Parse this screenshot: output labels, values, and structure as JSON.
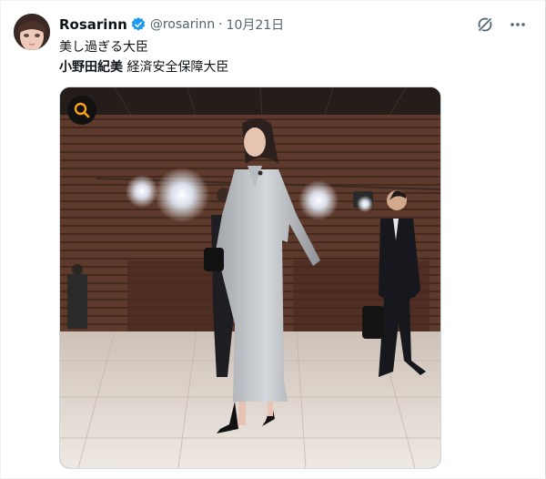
{
  "tweet": {
    "author_name": "Rosarinn",
    "handle": "@rosarinn",
    "separator": "·",
    "date": "10月21日",
    "text_line1": "美し過ぎる大臣",
    "text_line2_bold": "小野田紀美",
    "text_line2_rest": " 経済安全保障大臣"
  },
  "icons": {
    "verified": "verified-badge-icon",
    "grok": "grok-icon",
    "more": "more-options-icon",
    "zoom": "search-zoom-icon"
  },
  "colors": {
    "verified_blue": "#1d9bf0",
    "zoom_accent": "#f7a21b",
    "text_secondary": "#536471"
  }
}
